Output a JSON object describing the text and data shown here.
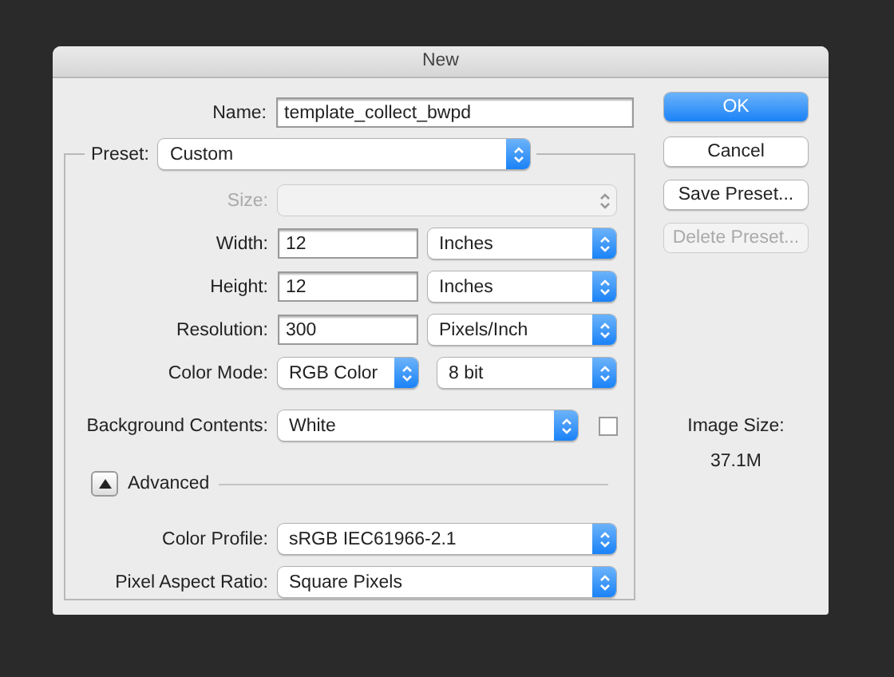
{
  "window": {
    "title": "New"
  },
  "name": {
    "label": "Name:",
    "value": "template_collect_bwpd"
  },
  "preset": {
    "label": "Preset:",
    "value": "Custom"
  },
  "fields": [
    {
      "kind": "select",
      "label": "Size:",
      "disabled": true
    },
    {
      "kind": "input_unit",
      "label": "Width:",
      "value": "12",
      "unit": "Inches"
    },
    {
      "kind": "input_unit",
      "label": "Height:",
      "value": "12",
      "unit": "Inches"
    },
    {
      "kind": "input_unit",
      "label": "Resolution:",
      "value": "300",
      "unit": "Pixels/Inch"
    },
    {
      "kind": "select_pair",
      "label": "Color Mode:",
      "value": "RGB Color",
      "unit": "8 bit"
    },
    {
      "kind": "select_check",
      "label": "Background Contents:",
      "value": "White",
      "checked": false
    }
  ],
  "advanced": {
    "label": "Advanced",
    "expanded": true,
    "fields": [
      {
        "kind": "select",
        "label": "Color Profile:",
        "value": "sRGB IEC61966-2.1",
        "disabled": false
      },
      {
        "kind": "select",
        "label": "Pixel Aspect Ratio:",
        "value": "Square Pixels",
        "disabled": false
      }
    ]
  },
  "buttons": [
    {
      "label": "OK",
      "default": true,
      "disabled": false
    },
    {
      "label": "Cancel",
      "default": false,
      "disabled": false
    },
    {
      "label": "Save Preset...",
      "default": false,
      "disabled": false
    },
    {
      "label": "Delete Preset...",
      "default": false,
      "disabled": true
    }
  ],
  "image_size": {
    "label": "Image Size:",
    "value": "37.1M"
  }
}
